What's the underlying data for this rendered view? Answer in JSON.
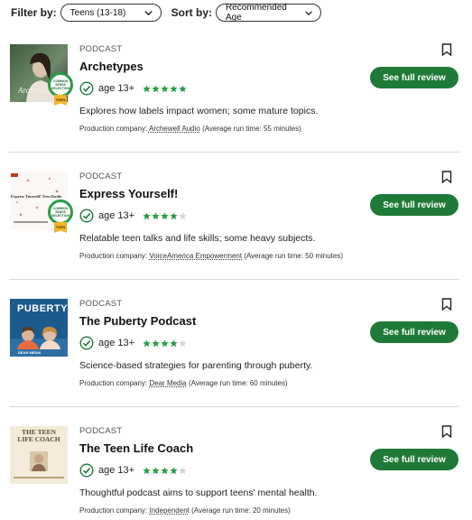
{
  "filters": {
    "filter_label": "Filter by:",
    "filter_value": "Teens (13-18)",
    "sort_label": "Sort by:",
    "sort_value": "Recommended Age"
  },
  "colors": {
    "accent": "#1f7a37",
    "star": "#2a9d47",
    "star_empty": "#d6d6d6"
  },
  "items": [
    {
      "type": "PODCAST",
      "title": "Archetypes",
      "age": "age 13+",
      "rating": 5,
      "description": "Explores how labels impact women; some mature topics.",
      "prod_prefix": "Production company: ",
      "company": "Archewell Audio",
      "runtime": " (Average run time: 55 minutes)",
      "review_button": "See full review",
      "thumb_text": "Archetypes",
      "seal_text": "COMMON SENSE SELECTION",
      "seal_ribbon": "TEEN"
    },
    {
      "type": "PODCAST",
      "title": "Express Yourself!",
      "age": "age 13+",
      "rating": 4,
      "description": "Relatable teen talks and life skills; some heavy subjects.",
      "prod_prefix": "Production company: ",
      "company": "VoiceAmerica Empowerment",
      "runtime": " (Average run time: 50 minutes)",
      "review_button": "See full review",
      "thumb_text": "Express Yourself! Teen Radio",
      "seal_text": "COMMON SENSE SELECTION",
      "seal_ribbon": "TEEN"
    },
    {
      "type": "PODCAST",
      "title": "The Puberty Podcast",
      "age": "age 13+",
      "rating": 4,
      "description": "Science-based strategies for parenting through puberty.",
      "prod_prefix": "Production company: ",
      "company": "Dear Media",
      "runtime": " (Average run time: 60 minutes)",
      "review_button": "See full review",
      "thumb_text": "PUBERTY",
      "thumb_sub": "DEAR MEDIA"
    },
    {
      "type": "PODCAST",
      "title": "The Teen Life Coach",
      "age": "age 13+",
      "rating": 4,
      "description": "Thoughtful podcast aims to support teens' mental health.",
      "prod_prefix": "Production company: ",
      "company": "Independent",
      "runtime": " (Average run time: 20 minutes)",
      "review_button": "See full review",
      "thumb_text": "THE TEEN LIFE COACH"
    }
  ]
}
